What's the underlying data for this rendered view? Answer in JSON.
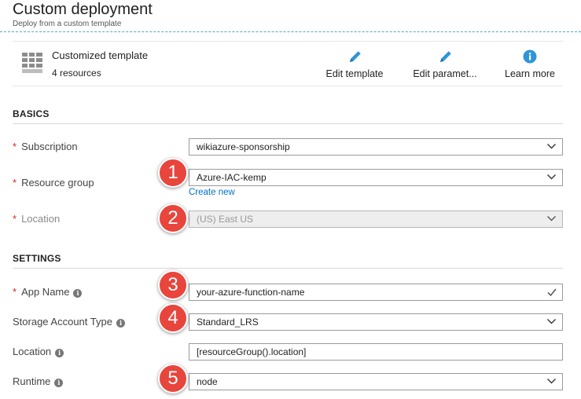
{
  "header": {
    "title": "Custom deployment",
    "subtitle": "Deploy from a custom template"
  },
  "template": {
    "name": "Customized template",
    "resources": "4 resources",
    "icon": "template-grid-icon"
  },
  "commands": {
    "edit_template": {
      "label": "Edit template",
      "icon": "pencil-icon"
    },
    "edit_parameters": {
      "label": "Edit paramet...",
      "icon": "pencil-icon"
    },
    "learn_more": {
      "label": "Learn more",
      "icon": "info-icon"
    }
  },
  "basics": {
    "heading": "BASICS",
    "subscription": {
      "label": "Subscription",
      "value": "wikiazure-sponsorship"
    },
    "resource_group": {
      "label": "Resource group",
      "value": "Azure-IAC-kemp",
      "create_new": "Create new"
    },
    "location": {
      "label": "Location",
      "value": "(US) East US"
    }
  },
  "settings": {
    "heading": "SETTINGS",
    "app_name": {
      "label": "App Name",
      "value": "your-azure-function-name"
    },
    "storage_type": {
      "label": "Storage Account Type",
      "value": "Standard_LRS"
    },
    "location": {
      "label": "Location",
      "value": "[resourceGroup().location]"
    },
    "runtime": {
      "label": "Runtime",
      "value": "node"
    }
  },
  "required_mark": "*",
  "info_mark": "i",
  "callouts": [
    "1",
    "2",
    "3",
    "4",
    "5"
  ],
  "colors": {
    "accent": "#0072c6",
    "icon_blue": "#2f95d8",
    "required": "#e02020",
    "callout": "#e8453c",
    "check": "#3a9a3a"
  }
}
